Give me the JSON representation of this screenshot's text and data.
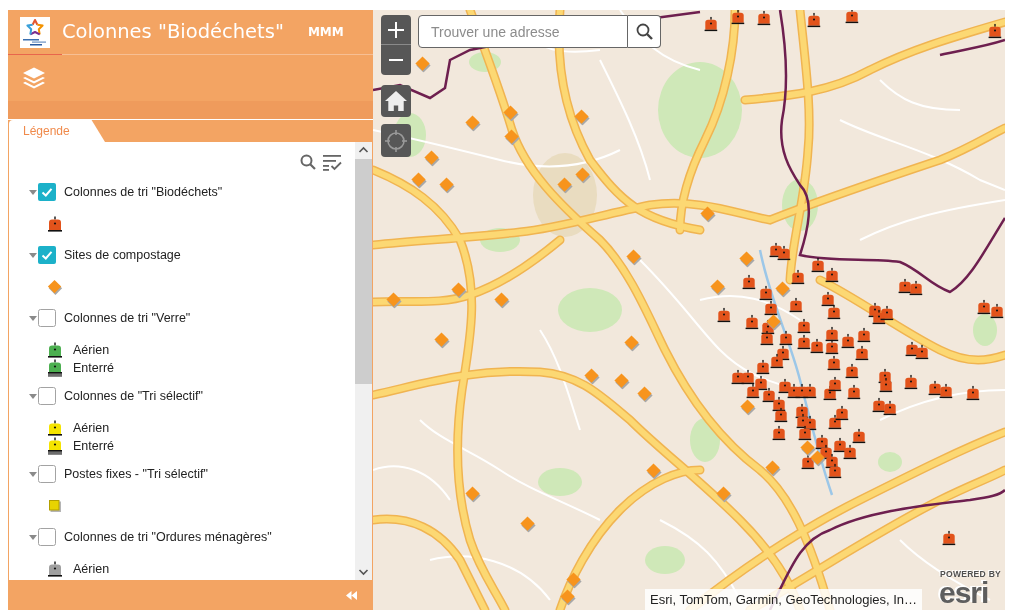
{
  "header": {
    "title": "Colonnes \"Biodéchets\"",
    "subtitle": "MMM"
  },
  "panel": {
    "tabs": [
      {
        "label": "Légende",
        "selected": true
      }
    ]
  },
  "legend": {
    "layers": [
      {
        "label": "Colonnes de tri \"Biodéchets\"",
        "checked": true,
        "expanded": true,
        "symbols": [
          {
            "kind": "container",
            "color": "#e2531b"
          }
        ]
      },
      {
        "label": "Sites de compostage",
        "checked": true,
        "expanded": true,
        "symbols": [
          {
            "kind": "diamond",
            "color": "#f7941d"
          }
        ]
      },
      {
        "label": "Colonnes de tri \"Verre\"",
        "checked": false,
        "expanded": true,
        "symbols": [
          {
            "kind": "container",
            "color": "#4caf50",
            "label": "Aérien"
          },
          {
            "kind": "buried-container",
            "color": "#4caf50",
            "label": "Enterré"
          }
        ]
      },
      {
        "label": "Colonnes de \"Tri sélectif\"",
        "checked": false,
        "expanded": true,
        "symbols": [
          {
            "kind": "container",
            "color": "#f5e400",
            "label": "Aérien"
          },
          {
            "kind": "buried-container",
            "color": "#f5e400",
            "label": "Enterré"
          }
        ]
      },
      {
        "label": "Postes fixes - \"Tri sélectif\"",
        "checked": false,
        "expanded": true,
        "symbols": [
          {
            "kind": "square",
            "color": "#e8d400"
          }
        ]
      },
      {
        "label": "Colonnes de tri \"Ordures ménagères\"",
        "checked": false,
        "expanded": true,
        "symbols": [
          {
            "kind": "container",
            "color": "#a0a0a0",
            "label": "Aérien"
          }
        ]
      }
    ]
  },
  "map": {
    "search": {
      "placeholder": "Trouver une adresse"
    },
    "attribution": "Esri, TomTom, Garmin, GeoTechnologies, In…",
    "logo": {
      "caption": "POWERED BY",
      "wordmark": "esri"
    }
  }
}
